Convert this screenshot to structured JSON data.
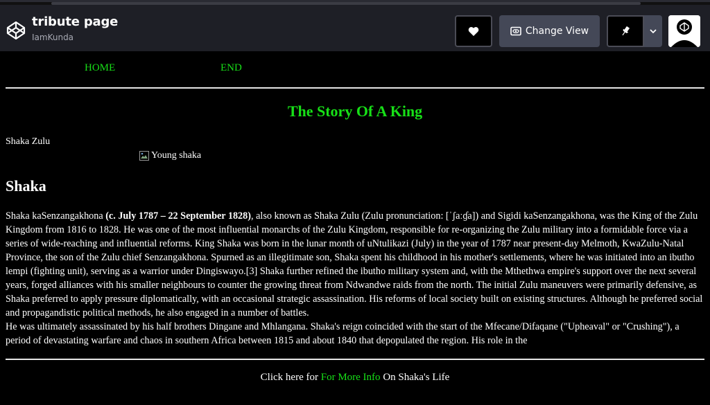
{
  "header": {
    "title": "tribute page",
    "author": "IamKunda",
    "change_view_label": "Change View"
  },
  "nav": {
    "home": "HOME",
    "end": "END"
  },
  "main": {
    "title": "The Story Of A King",
    "caption": "Shaka Zulu",
    "image_alt": "Young shaka",
    "heading": "Shaka",
    "bio": {
      "part1": "Shaka kaSenzangakhona ",
      "bold": "(c. July 1787 – 22 September 1828)",
      "part2": ", also known as Shaka Zulu (Zulu pronunciation: [ˈʃaːɠa]) and Sigidi kaSenzangakhona, was the King of the Zulu Kingdom from 1816 to 1828. He was one of the most influential monarchs of the Zulu Kingdom, responsible for re-organizing the Zulu military into a formidable force via a series of wide-reaching and influential reforms. King Shaka was born in the lunar month of uNtulikazi (July) in the year of 1787 near present-day Melmoth, KwaZulu-Natal Province, the son of the Zulu chief Senzangakhona. Spurned as an illegitimate son, Shaka spent his childhood in his mother's settlements, where he was initiated into an ibutho lempi (fighting unit), serving as a warrior under Dingiswayo.[3] Shaka further refined the ibutho military system and, with the Mthethwa empire's support over the next several years, forged alliances with his smaller neighbours to counter the growing threat from Ndwandwe raids from the north. The initial Zulu maneuvers were primarily defensive, as Shaka preferred to apply pressure diplomatically, with an occasional strategic assassination. His reforms of local society built on existing structures. Although he preferred social and propagandistic political methods, he also engaged in a number of battles.",
      "part3": "He was ultimately assassinated by his half brothers Dingane and Mhlangana. Shaka's reign coincided with the start of the Mfecane/Difaqane (\"Upheaval\" or \"Crushing\"), a period of devastating warfare and chaos in southern Africa between 1815 and about 1840 that depopulated the region. His role in the"
    }
  },
  "footer": {
    "prefix": "Click here for ",
    "link": "For More Info",
    "suffix": " On Shaka's Life"
  },
  "colors": {
    "accent_green": "#17e017",
    "header_bg": "#1e1f26",
    "button_bg": "#444857"
  }
}
